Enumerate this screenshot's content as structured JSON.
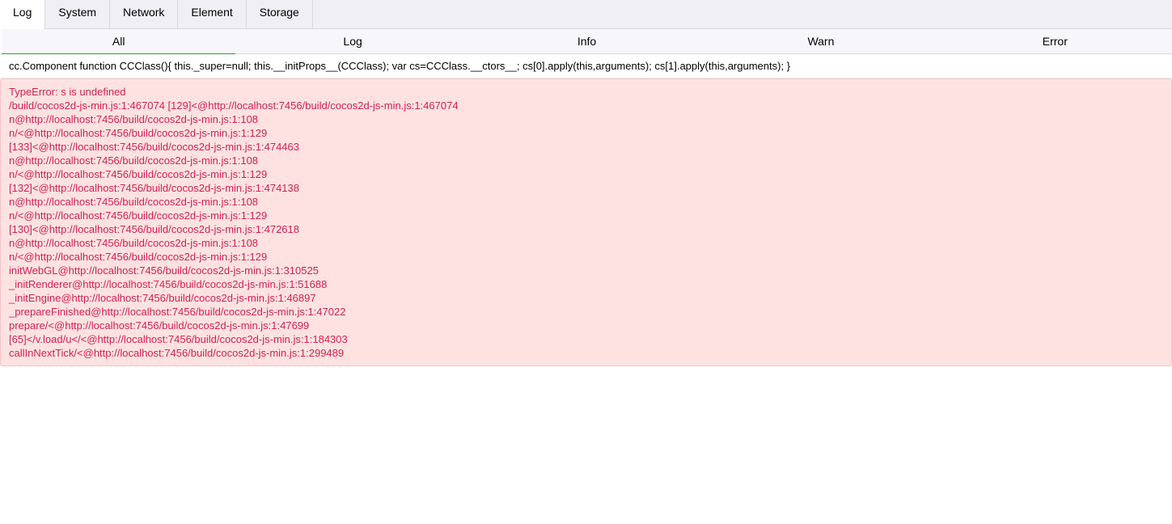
{
  "tabs": [
    {
      "label": "Log"
    },
    {
      "label": "System"
    },
    {
      "label": "Network"
    },
    {
      "label": "Element"
    },
    {
      "label": "Storage"
    }
  ],
  "filters": [
    {
      "label": "All"
    },
    {
      "label": "Log"
    },
    {
      "label": "Info"
    },
    {
      "label": "Warn"
    },
    {
      "label": "Error"
    }
  ],
  "log_entry": {
    "text": "cc.Component function CCClass(){ this._super=null; this.__initProps__(CCClass); var cs=CCClass.__ctors__; cs[0].apply(this,arguments); cs[1].apply(this,arguments); }"
  },
  "error_entry": {
    "lines": [
      "TypeError: s is undefined",
      "/build/cocos2d-js-min.js:1:467074 [129]<@http://localhost:7456/build/cocos2d-js-min.js:1:467074",
      "n@http://localhost:7456/build/cocos2d-js-min.js:1:108",
      "n/<@http://localhost:7456/build/cocos2d-js-min.js:1:129",
      "[133]<@http://localhost:7456/build/cocos2d-js-min.js:1:474463",
      "n@http://localhost:7456/build/cocos2d-js-min.js:1:108",
      "n/<@http://localhost:7456/build/cocos2d-js-min.js:1:129",
      "[132]<@http://localhost:7456/build/cocos2d-js-min.js:1:474138",
      "n@http://localhost:7456/build/cocos2d-js-min.js:1:108",
      "n/<@http://localhost:7456/build/cocos2d-js-min.js:1:129",
      "[130]<@http://localhost:7456/build/cocos2d-js-min.js:1:472618",
      "n@http://localhost:7456/build/cocos2d-js-min.js:1:108",
      "n/<@http://localhost:7456/build/cocos2d-js-min.js:1:129",
      "initWebGL@http://localhost:7456/build/cocos2d-js-min.js:1:310525",
      "_initRenderer@http://localhost:7456/build/cocos2d-js-min.js:1:51688",
      "_initEngine@http://localhost:7456/build/cocos2d-js-min.js:1:46897",
      "_prepareFinished@http://localhost:7456/build/cocos2d-js-min.js:1:47022",
      "prepare/<@http://localhost:7456/build/cocos2d-js-min.js:1:47699",
      "[65]</v.load/u</<@http://localhost:7456/build/cocos2d-js-min.js:1:184303",
      "callInNextTick/<@http://localhost:7456/build/cocos2d-js-min.js:1:299489"
    ]
  },
  "colors": {
    "error_text": "#d0234c",
    "error_background": "#fee2e2",
    "active_filter_underline": "#1aad19"
  }
}
